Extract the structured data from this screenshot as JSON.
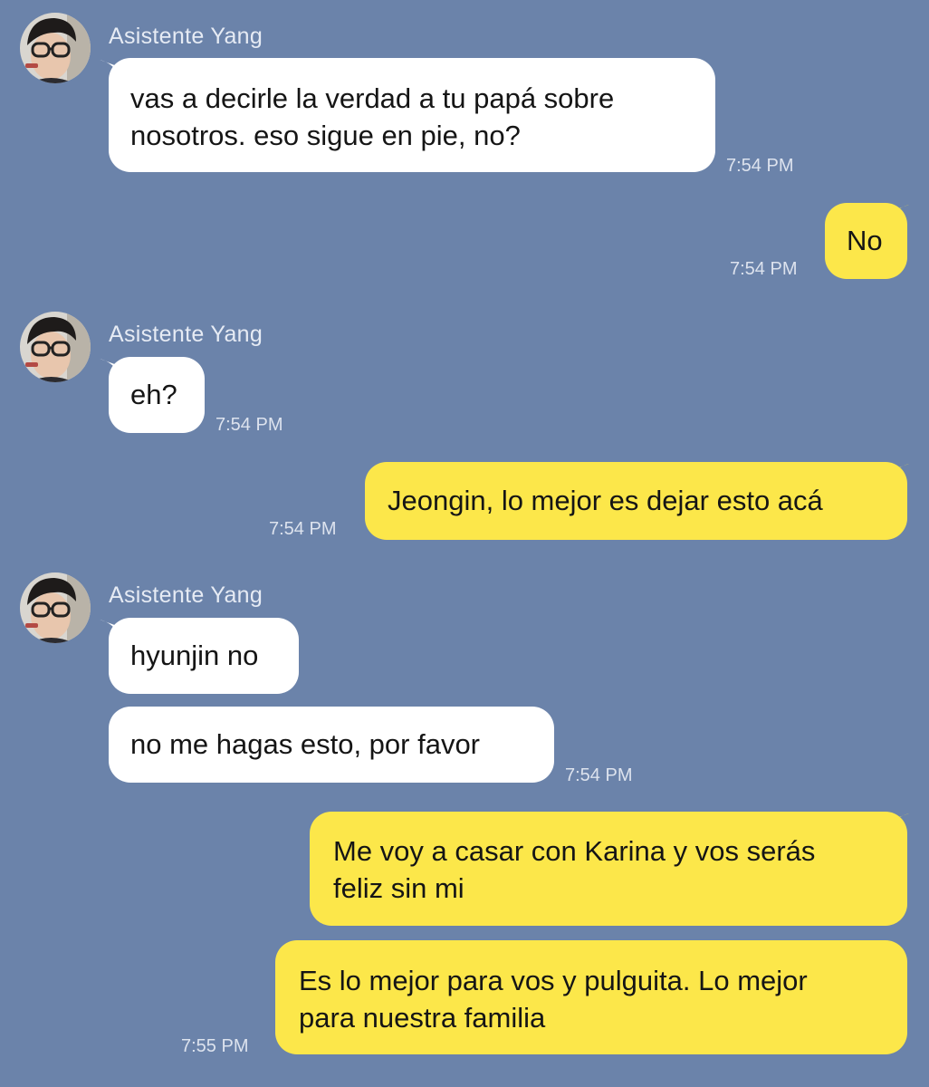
{
  "colors": {
    "background": "#6b83aa",
    "incoming_bubble": "#ffffff",
    "outgoing_bubble": "#fce74a",
    "meta_text": "#dde3ee"
  },
  "icons": [
    "contact-avatar"
  ],
  "messages": [
    {
      "id": "m1",
      "direction": "incoming",
      "sender": "Asistente Yang",
      "text": "vas a decirle la verdad a tu papá sobre\nnosotros. eso sigue en pie, no?",
      "time": "7:54 PM"
    },
    {
      "id": "m2",
      "direction": "outgoing",
      "text": "No",
      "time": "7:54 PM"
    },
    {
      "id": "m3",
      "direction": "incoming",
      "sender": "Asistente Yang",
      "text": "eh?",
      "time": "7:54 PM"
    },
    {
      "id": "m4",
      "direction": "outgoing",
      "text": "Jeongin, lo mejor es dejar esto acá",
      "time": "7:54 PM"
    },
    {
      "id": "m5",
      "direction": "incoming",
      "sender": "Asistente Yang",
      "text": "hyunjin no"
    },
    {
      "id": "m6",
      "direction": "incoming",
      "text": "no me hagas esto, por favor",
      "time": "7:54 PM"
    },
    {
      "id": "m7",
      "direction": "outgoing",
      "text": "Me voy a casar con Karina y vos serás\nfeliz sin mi"
    },
    {
      "id": "m8",
      "direction": "outgoing",
      "text": "Es lo mejor para vos y pulguita. Lo mejor\npara nuestra familia",
      "time": "7:55 PM"
    }
  ]
}
